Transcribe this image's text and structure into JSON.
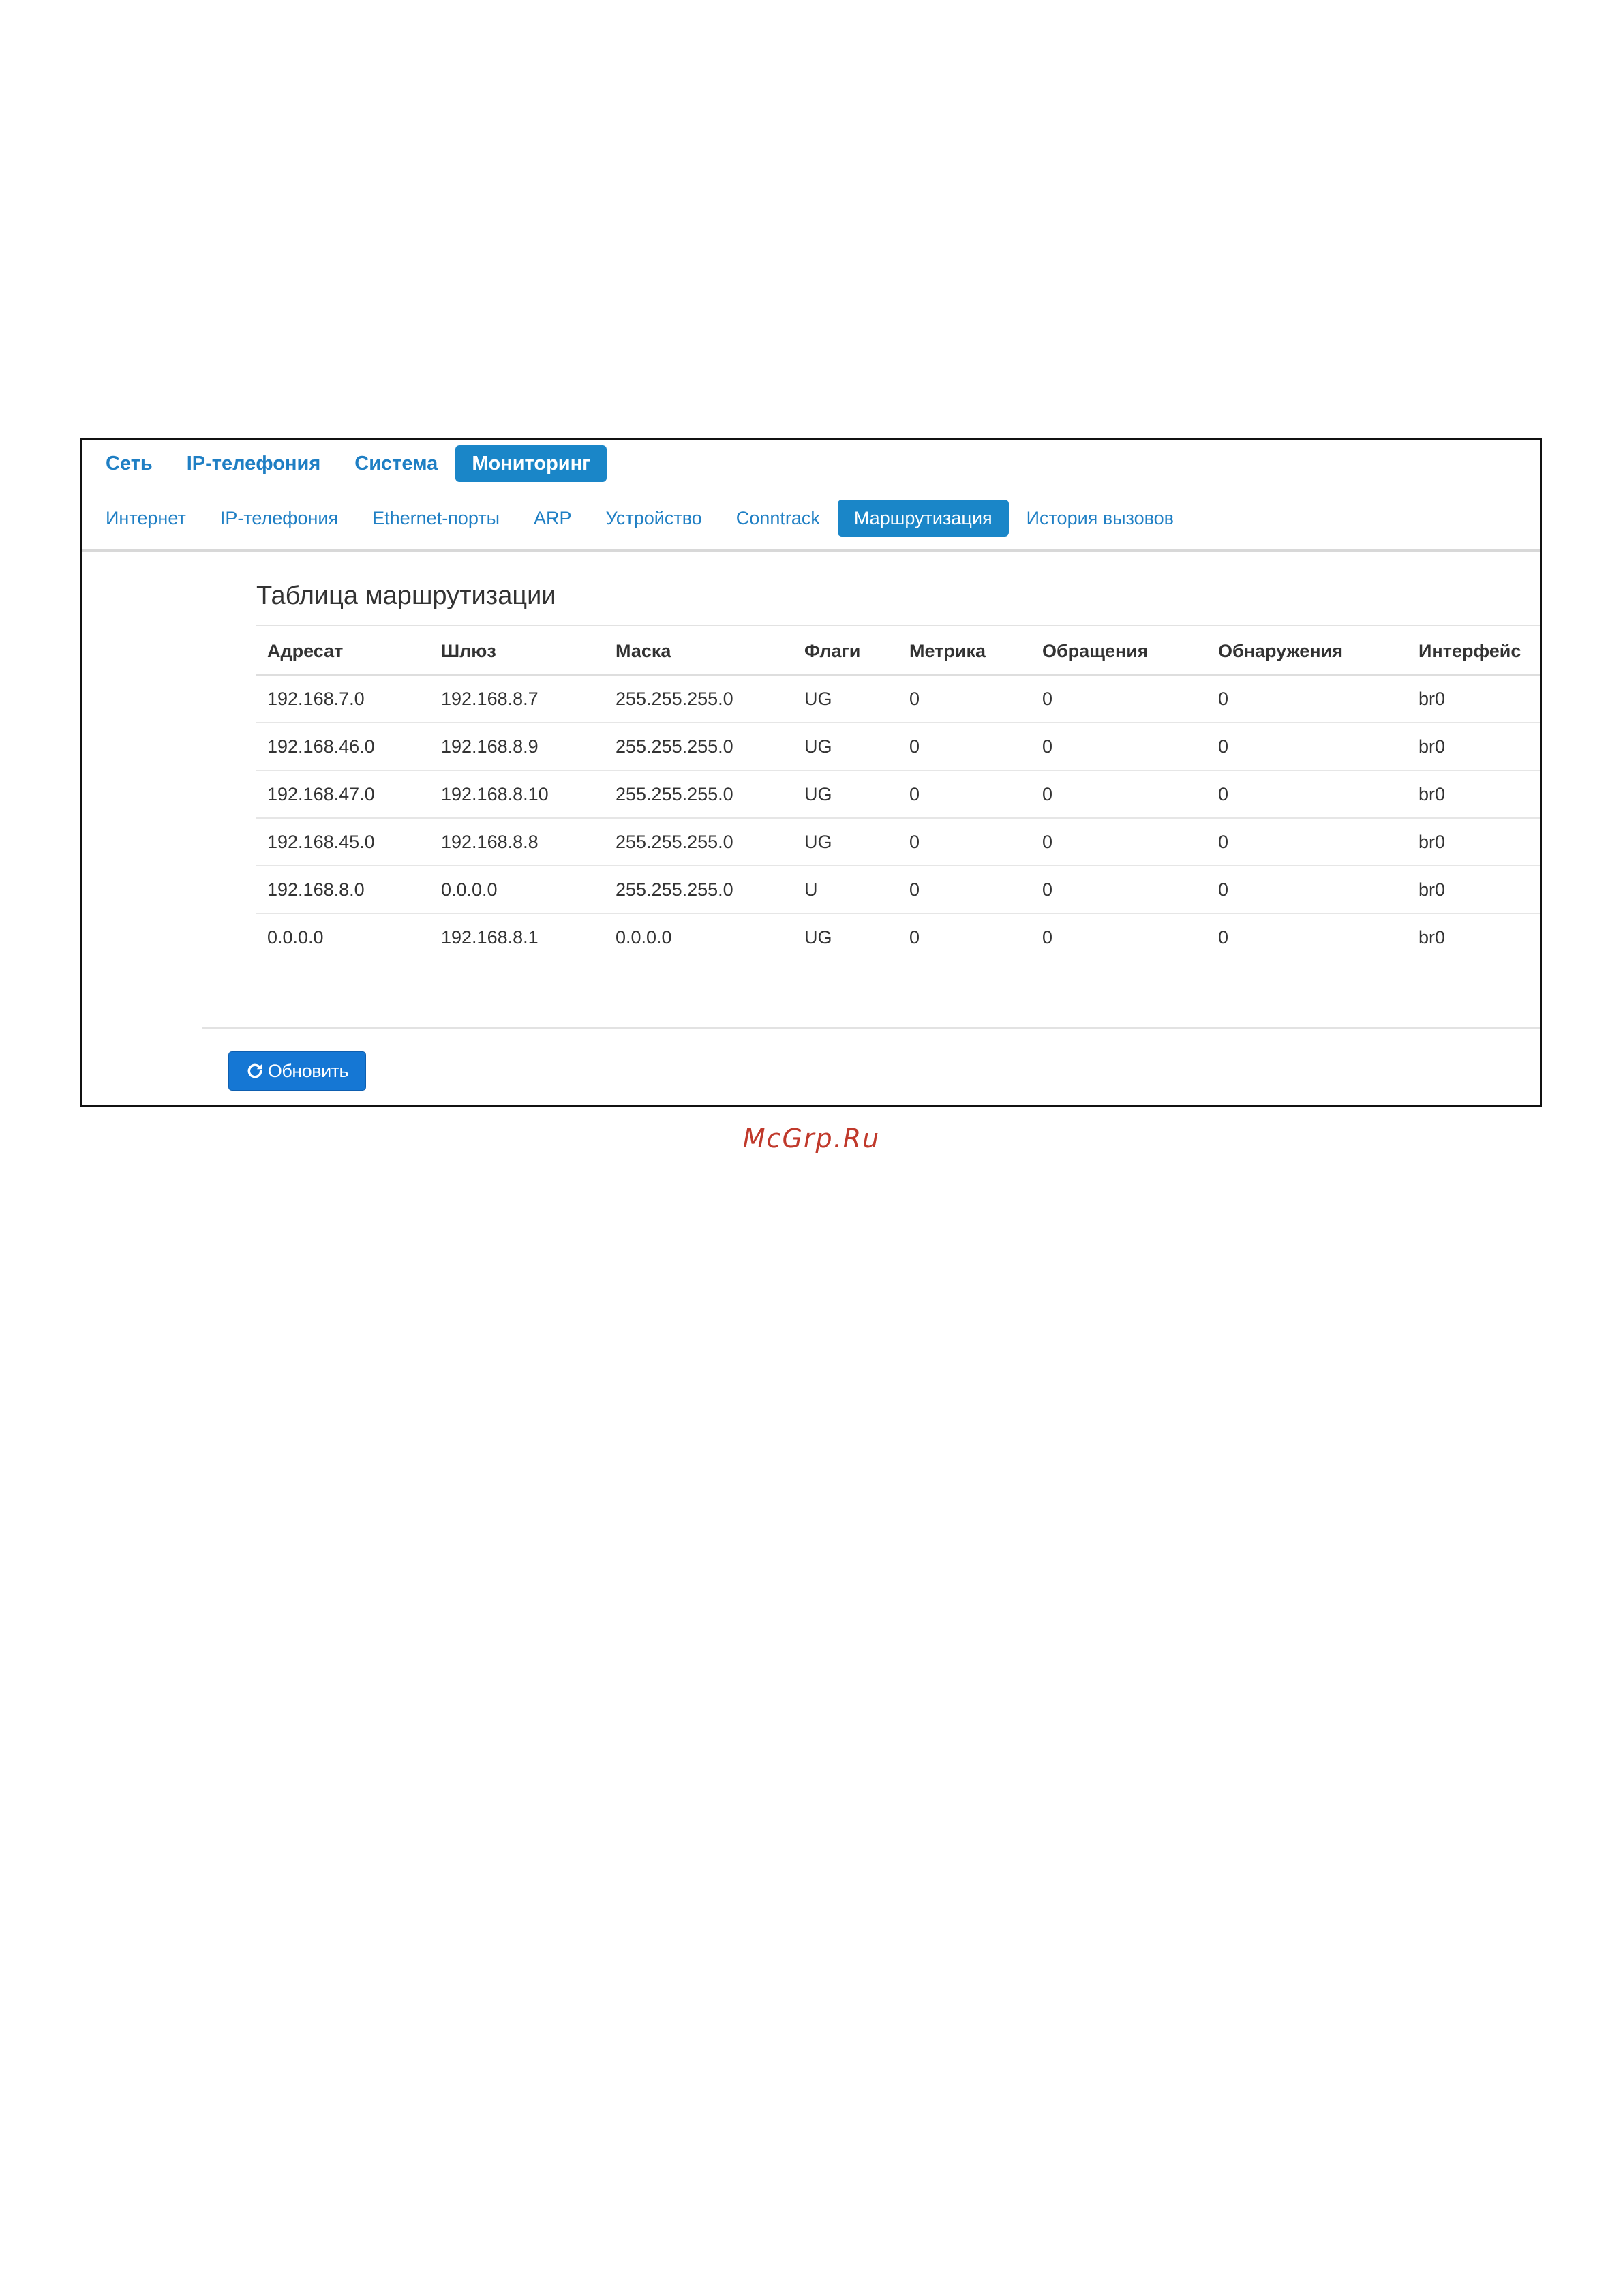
{
  "top_nav": {
    "items": [
      {
        "label": "Сеть",
        "active": false
      },
      {
        "label": "IP-телефония",
        "active": false
      },
      {
        "label": "Система",
        "active": false
      },
      {
        "label": "Мониторинг",
        "active": true
      }
    ]
  },
  "sub_nav": {
    "items": [
      {
        "label": "Интернет",
        "active": false
      },
      {
        "label": "IP-телефония",
        "active": false
      },
      {
        "label": "Ethernet-порты",
        "active": false
      },
      {
        "label": "ARP",
        "active": false
      },
      {
        "label": "Устройство",
        "active": false
      },
      {
        "label": "Conntrack",
        "active": false
      },
      {
        "label": "Маршрутизация",
        "active": true
      },
      {
        "label": "История вызовов",
        "active": false
      }
    ]
  },
  "panel": {
    "title": "Таблица маршрутизации"
  },
  "routing_table": {
    "headers": [
      "Адресат",
      "Шлюз",
      "Маска",
      "Флаги",
      "Метрика",
      "Обращения",
      "Обнаружения",
      "Интерфейс"
    ],
    "rows": [
      [
        "192.168.7.0",
        "192.168.8.7",
        "255.255.255.0",
        "UG",
        "0",
        "0",
        "0",
        "br0"
      ],
      [
        "192.168.46.0",
        "192.168.8.9",
        "255.255.255.0",
        "UG",
        "0",
        "0",
        "0",
        "br0"
      ],
      [
        "192.168.47.0",
        "192.168.8.10",
        "255.255.255.0",
        "UG",
        "0",
        "0",
        "0",
        "br0"
      ],
      [
        "192.168.45.0",
        "192.168.8.8",
        "255.255.255.0",
        "UG",
        "0",
        "0",
        "0",
        "br0"
      ],
      [
        "192.168.8.0",
        "0.0.0.0",
        "255.255.255.0",
        "U",
        "0",
        "0",
        "0",
        "br0"
      ],
      [
        "0.0.0.0",
        "192.168.8.1",
        "0.0.0.0",
        "UG",
        "0",
        "0",
        "0",
        "br0"
      ]
    ]
  },
  "actions": {
    "refresh_label": "Обновить",
    "refresh_icon": "refresh-icon"
  },
  "watermark": {
    "text": "McGrp.Ru"
  },
  "colors": {
    "accent": "#1a86c8",
    "link": "#1f7fc4",
    "button": "#1577d4",
    "watermark": "#c0392b"
  }
}
